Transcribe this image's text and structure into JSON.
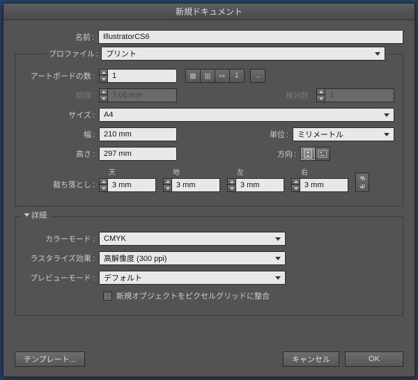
{
  "title": "新規ドキュメント",
  "name": {
    "label": "名前",
    "value": "IllustratorCS6"
  },
  "profile": {
    "label": "プロファイル",
    "value": "プリント"
  },
  "artboards": {
    "label": "アートボードの数",
    "value": "1"
  },
  "spacing": {
    "label": "間隔",
    "value": "7.06 mm"
  },
  "columns": {
    "label": "横列数",
    "value": "1"
  },
  "size": {
    "label": "サイズ",
    "value": "A4"
  },
  "width": {
    "label": "幅",
    "value": "210 mm"
  },
  "height": {
    "label": "高さ",
    "value": "297 mm"
  },
  "units": {
    "label": "単位",
    "value": "ミリメートル"
  },
  "orientation": {
    "label": "方向"
  },
  "bleed": {
    "label": "裁ち落とし",
    "top": {
      "label": "天",
      "value": "3 mm"
    },
    "bottom": {
      "label": "地",
      "value": "3 mm"
    },
    "left": {
      "label": "左",
      "value": "3 mm"
    },
    "right": {
      "label": "右",
      "value": "3 mm"
    }
  },
  "advanced": {
    "label": "詳細"
  },
  "colorMode": {
    "label": "カラーモード",
    "value": "CMYK"
  },
  "raster": {
    "label": "ラスタライズ効果",
    "value": "高解像度 (300 ppi)"
  },
  "preview": {
    "label": "プレビューモード",
    "value": "デフォルト"
  },
  "pixelGrid": {
    "label": "新規オブジェクトをピクセルグリッドに整合"
  },
  "buttons": {
    "template": "テンプレート...",
    "cancel": "キャンセル",
    "ok": "OK"
  }
}
